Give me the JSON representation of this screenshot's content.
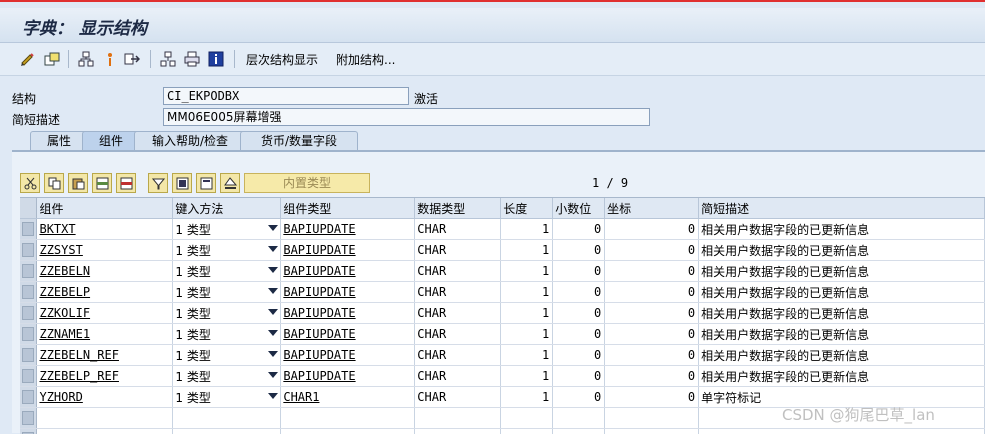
{
  "title": "字典： 显示结构",
  "toolbar": {
    "icons": [
      "pencil-icon",
      "other-object-icon",
      "where-used-icon",
      "info-icon",
      "navigate-icon",
      "hierarchy-icon",
      "print-icon",
      "info-box-icon"
    ],
    "hierarchy_label": "层次结构显示",
    "append_label": "附加结构..."
  },
  "header": {
    "structure_label": "结构",
    "structure_value": "CI_EKPODBX",
    "status": "激活",
    "desc_label": "简短描述",
    "desc_value": "MM06E005屏幕增强"
  },
  "tabs": [
    "属性",
    "组件",
    "输入帮助/检查",
    "货币/数量字段"
  ],
  "active_tab": 1,
  "table_toolbar": {
    "builtin_type_label": "内置类型",
    "pager": "1 / 9"
  },
  "columns": [
    "组件",
    "键入方法",
    "组件类型",
    "数据类型",
    "长度",
    "小数位",
    "坐标",
    "简短描述"
  ],
  "rows": [
    {
      "component": "BKTXT",
      "method": "1 类型",
      "type": "BAPIUPDATE",
      "dtype": "CHAR",
      "len": "1",
      "dec": "0",
      "coord": "0",
      "desc": "相关用户数据字段的已更新信息"
    },
    {
      "component": "ZZSYST",
      "method": "1 类型",
      "type": "BAPIUPDATE",
      "dtype": "CHAR",
      "len": "1",
      "dec": "0",
      "coord": "0",
      "desc": "相关用户数据字段的已更新信息"
    },
    {
      "component": "ZZEBELN",
      "method": "1 类型",
      "type": "BAPIUPDATE",
      "dtype": "CHAR",
      "len": "1",
      "dec": "0",
      "coord": "0",
      "desc": "相关用户数据字段的已更新信息"
    },
    {
      "component": "ZZEBELP",
      "method": "1 类型",
      "type": "BAPIUPDATE",
      "dtype": "CHAR",
      "len": "1",
      "dec": "0",
      "coord": "0",
      "desc": "相关用户数据字段的已更新信息"
    },
    {
      "component": "ZZKOLIF",
      "method": "1 类型",
      "type": "BAPIUPDATE",
      "dtype": "CHAR",
      "len": "1",
      "dec": "0",
      "coord": "0",
      "desc": "相关用户数据字段的已更新信息"
    },
    {
      "component": "ZZNAME1",
      "method": "1 类型",
      "type": "BAPIUPDATE",
      "dtype": "CHAR",
      "len": "1",
      "dec": "0",
      "coord": "0",
      "desc": "相关用户数据字段的已更新信息"
    },
    {
      "component": "ZZEBELN_REF",
      "method": "1 类型",
      "type": "BAPIUPDATE",
      "dtype": "CHAR",
      "len": "1",
      "dec": "0",
      "coord": "0",
      "desc": "相关用户数据字段的已更新信息"
    },
    {
      "component": "ZZEBELP_REF",
      "method": "1 类型",
      "type": "BAPIUPDATE",
      "dtype": "CHAR",
      "len": "1",
      "dec": "0",
      "coord": "0",
      "desc": "相关用户数据字段的已更新信息"
    },
    {
      "component": "YZHORD",
      "method": "1 类型",
      "type": "CHAR1",
      "dtype": "CHAR",
      "len": "1",
      "dec": "0",
      "coord": "0",
      "desc": "单字符标记"
    }
  ],
  "watermark": "CSDN @狗尾巴草_lan"
}
